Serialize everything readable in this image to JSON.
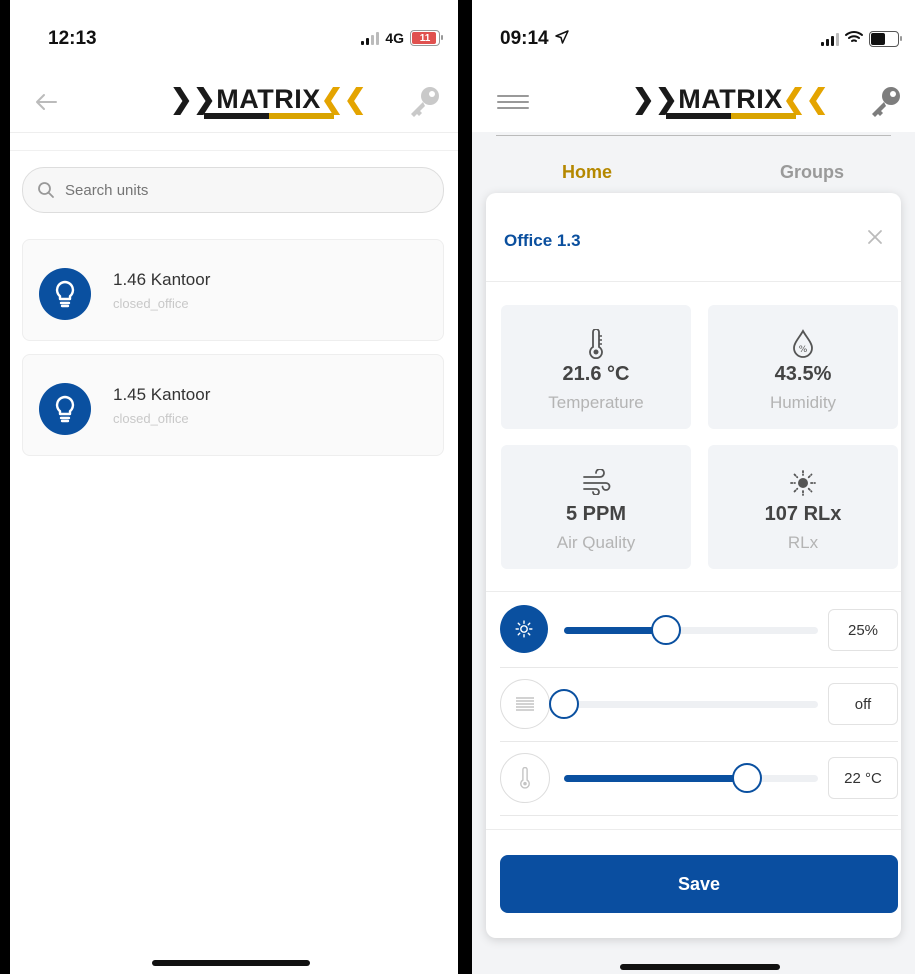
{
  "left_screen": {
    "status": {
      "time": "12:13",
      "network": "4G",
      "battery": "11"
    },
    "header": {
      "logo_text": "MATRIX"
    },
    "search": {
      "placeholder": "Search units"
    },
    "units": [
      {
        "name": "1.46 Kantoor",
        "type": "closed_office"
      },
      {
        "name": "1.45 Kantoor",
        "type": "closed_office"
      }
    ]
  },
  "right_screen": {
    "status": {
      "time": "09:14"
    },
    "header": {
      "logo_text": "MATRIX"
    },
    "tabs": [
      {
        "label": "Home"
      },
      {
        "label": "Groups"
      }
    ],
    "modal": {
      "title": "Office 1.3",
      "sensors": [
        {
          "value": "21.6 °C",
          "label": "Temperature",
          "icon": "thermometer-icon"
        },
        {
          "value": "43.5%",
          "label": "Humidity",
          "icon": "humidity-drop-icon"
        },
        {
          "value": "5 PPM",
          "label": "Air Quality",
          "icon": "wind-icon"
        },
        {
          "value": "107 RLx",
          "label": "RLx",
          "icon": "brightness-icon"
        }
      ],
      "controls": [
        {
          "name": "light-level",
          "value": "25%",
          "level": 0.4,
          "active": true,
          "icon": "brightness-icon"
        },
        {
          "name": "blinds",
          "value": "off",
          "level": 0.0,
          "active": false,
          "icon": "blinds-icon"
        },
        {
          "name": "temperature-setpoint",
          "value": "22 °C",
          "level": 0.72,
          "active": false,
          "icon": "thermometer-icon"
        }
      ],
      "save_label": "Save"
    }
  },
  "colors": {
    "brand_blue": "#0a50a0",
    "accent_gold": "#d9a400",
    "muted_text": "#b4b4b4"
  }
}
